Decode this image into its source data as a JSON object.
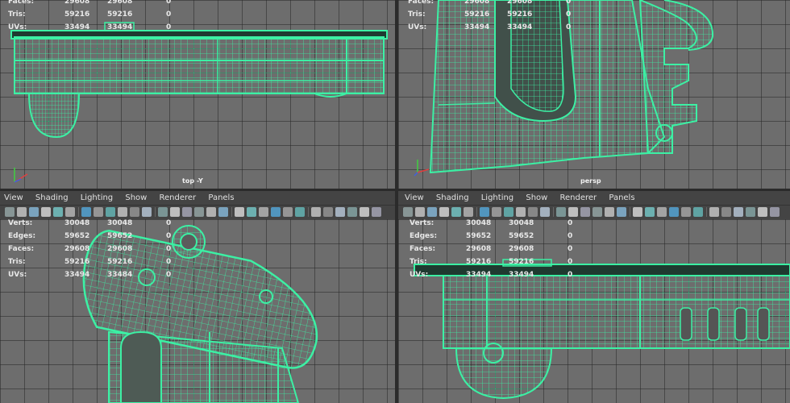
{
  "colors": {
    "wire": "#3cf0a4",
    "bg": "#6d6d6d",
    "text": "#e8e8e8"
  },
  "stats_labels": [
    "Verts:",
    "Edges:",
    "Faces:",
    "Tris:",
    "UVs:"
  ],
  "viewports": {
    "top_left": {
      "camera": "top -Y",
      "rows": [
        {
          "label": "Faces:",
          "a": "29608",
          "b": "29608",
          "c": "0"
        },
        {
          "label": "Tris:",
          "a": "59216",
          "b": "59216",
          "c": "0"
        },
        {
          "label": "UVs:",
          "a": "33494",
          "b": "33494",
          "c": "0"
        }
      ]
    },
    "top_right": {
      "camera": "persp",
      "rows": [
        {
          "label": "Faces:",
          "a": "29608",
          "b": "29608",
          "c": "0"
        },
        {
          "label": "Tris:",
          "a": "59216",
          "b": "59216",
          "c": "0"
        },
        {
          "label": "UVs:",
          "a": "33494",
          "b": "33494",
          "c": "0"
        }
      ]
    },
    "bottom_left": {
      "menu": [
        "View",
        "Shading",
        "Lighting",
        "Show",
        "Renderer",
        "Panels"
      ],
      "rows": [
        {
          "label": "Verts:",
          "a": "30048",
          "b": "30048",
          "c": "0"
        },
        {
          "label": "Edges:",
          "a": "59652",
          "b": "59652",
          "c": "0"
        },
        {
          "label": "Faces:",
          "a": "29608",
          "b": "29608",
          "c": "0"
        },
        {
          "label": "Tris:",
          "a": "59216",
          "b": "59216",
          "c": "0"
        },
        {
          "label": "UVs:",
          "a": "33494",
          "b": "33484",
          "c": "0"
        }
      ]
    },
    "bottom_right": {
      "menu": [
        "View",
        "Shading",
        "Lighting",
        "Show",
        "Renderer",
        "Panels"
      ],
      "rows": [
        {
          "label": "Verts:",
          "a": "30048",
          "b": "30048",
          "c": "0"
        },
        {
          "label": "Edges:",
          "a": "59652",
          "b": "59652",
          "c": "0"
        },
        {
          "label": "Faces:",
          "a": "29608",
          "b": "29608",
          "c": "0"
        },
        {
          "label": "Tris:",
          "a": "59216",
          "b": "59216",
          "c": "0"
        },
        {
          "label": "UVs:",
          "a": "33494",
          "b": "33494",
          "c": "0"
        }
      ]
    }
  },
  "toolbar_icons": [
    "camera-icon",
    "bookmark-icon",
    "grease-pencil-icon",
    "image-plane-icon",
    "2d-pan-icon",
    "grid-icon",
    "wireframe-icon",
    "smooth-shade-icon",
    "textured-icon",
    "lights-icon",
    "shadows-icon",
    "isolate-icon",
    "xray-icon",
    "resolution-gate-icon",
    "panel-layout-icon"
  ]
}
